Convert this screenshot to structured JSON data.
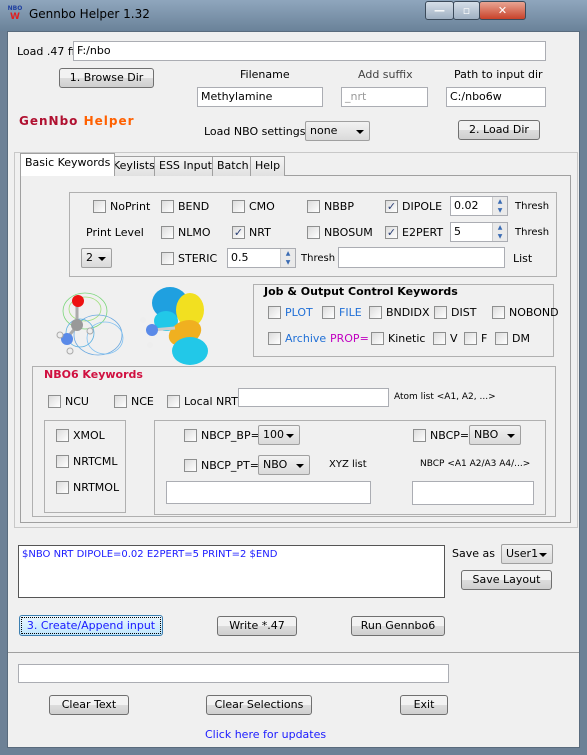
{
  "window": {
    "title": "Gennbo Helper 1.32",
    "icon_top": "NBO",
    "icon_bottom": "W",
    "min": "—",
    "max": "▫",
    "close": "✕"
  },
  "top": {
    "load_label": "Load .47 file",
    "load_value": "F:/nbo",
    "browse": "1. Browse Dir",
    "filename_label": "Filename",
    "filename_value": "Methylamine",
    "suffix_label": "Add suffix",
    "suffix_value": "_nrt",
    "path_label": "Path to input dir",
    "path_value": "C:/nbo6w",
    "logo_a": "GenNbo",
    "logo_b": "Helper",
    "settings_label": "Load NBO settings",
    "settings_value": "none",
    "load_dir": "2. Load Dir"
  },
  "tabs": [
    "Basic Keywords",
    "Keylists",
    "ESS Input",
    "Batch",
    "Help"
  ],
  "basic": {
    "noprint": {
      "label": "NoPrint",
      "checked": false
    },
    "bend": {
      "label": "BEND",
      "checked": false
    },
    "cmo": {
      "label": "CMO",
      "checked": false
    },
    "nbbp": {
      "label": "NBBP",
      "checked": false
    },
    "dipole": {
      "label": "DIPOLE",
      "checked": true
    },
    "dipole_thresh": "0.02",
    "print_level_label": "Print Level",
    "nlmo": {
      "label": "NLMO",
      "checked": false
    },
    "nrt": {
      "label": "NRT",
      "checked": true
    },
    "nbosum": {
      "label": "NBOSUM",
      "checked": false
    },
    "e2pert": {
      "label": "E2PERT",
      "checked": true
    },
    "e2pert_thresh": "5",
    "print_level": "2",
    "steric": {
      "label": "STERIC",
      "checked": false
    },
    "steric_thresh": "0.5",
    "thresh_label": "Thresh",
    "list_label": "List",
    "list_value": ""
  },
  "job": {
    "title": "Job & Output Control Keywords",
    "plot": "PLOT",
    "file": "FILE",
    "bndidx": "BNDIDX",
    "dist": "DIST",
    "nobond": "NOBOND",
    "archive": "Archive",
    "prop": "PROP=",
    "kinetic": "Kinetic",
    "v": "V",
    "f": "F",
    "dm": "DM"
  },
  "nbo6": {
    "title": "NBO6 Keywords",
    "ncu": "NCU",
    "nce": "NCE",
    "local_nrt": "Local NRT",
    "atom_list_label": "Atom list <A1, A2, ...>",
    "xmol": "XMOL",
    "nrtcml": "NRTCML",
    "nrtmol": "NRTMOL",
    "nbcp_bp": "NBCP_BP=",
    "nbcp_bp_value": "100",
    "nbcp": "NBCP=",
    "nbcp_value": "NBO",
    "nbcp_pt": "NBCP_PT=",
    "nbcp_pt_value": "NBO",
    "xyz_label": "XYZ list",
    "nbcp_list_label": "NBCP <A1 A2/A3 A4/...>"
  },
  "output": {
    "text": "$NBO NRT DIPOLE=0.02 E2PERT=5 PRINT=2 $END",
    "save_as_label": "Save as",
    "save_as_value": "User1",
    "save_layout": "Save Layout"
  },
  "actions": {
    "create": "3. Create/Append input",
    "write": "Write *.47",
    "run": "Run Gennbo6",
    "status": "",
    "clear_text": "Clear Text",
    "clear_sel": "Clear Selections",
    "exit": "Exit",
    "updates": "Click here for updates"
  },
  "colors": {
    "link": "#1a1aff",
    "job_blue": "#1f6fd6",
    "prop": "#c000c0",
    "nbo6_title": "#d01040",
    "logo_a": "#b01030",
    "logo_b": "#ff6000"
  }
}
